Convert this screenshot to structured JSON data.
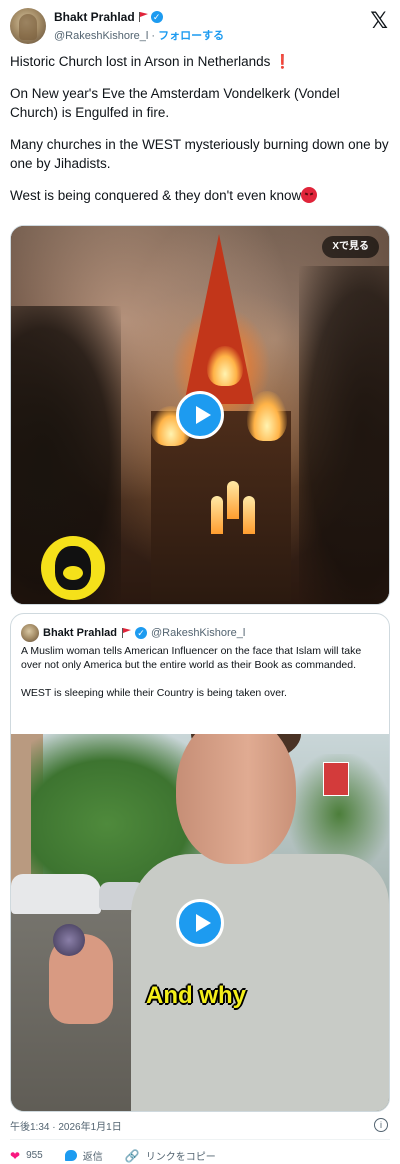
{
  "author": {
    "display_name": "Bhakt Prahlad",
    "handle": "@RakeshKishore_l",
    "separator": "·",
    "follow_label": "フォローする"
  },
  "tweet": {
    "paragraphs": [
      "Historic Church lost in Arson in Netherlands ❗",
      "On New year's Eve the Amsterdam Vondelkerk (Vondel Church) is Engulfed in fire.",
      "Many churches in the WEST mysteriously burning down one by one by Jihadists.",
      "West is being conquered & they don't even know"
    ],
    "media_overlay_label": "Xで見る"
  },
  "quote": {
    "display_name": "Bhakt Prahlad",
    "handle": "@RakeshKishore_l",
    "paragraphs": [
      "A Muslim woman tells American Influencer on the face that Islam will take over not only America but the entire world as their Book as commanded.",
      "WEST is sleeping while their Country is being taken over."
    ],
    "caption": "And why"
  },
  "timestamp": "午後1:34 · 2026年1月1日",
  "actions": {
    "likes": "955",
    "reply_label": "返信",
    "copy_link_label": "リンクをコピー"
  },
  "icons": [
    "flag-icon",
    "verified-icon",
    "x-logo-icon",
    "play-icon",
    "info-icon",
    "heart-icon",
    "reply-icon",
    "link-icon",
    "angry-face-emoji"
  ],
  "colors": {
    "accent": "#1d9bf0",
    "heart": "#f91880",
    "secondary_text": "#536471",
    "caption_yellow": "#f3ee1a"
  }
}
